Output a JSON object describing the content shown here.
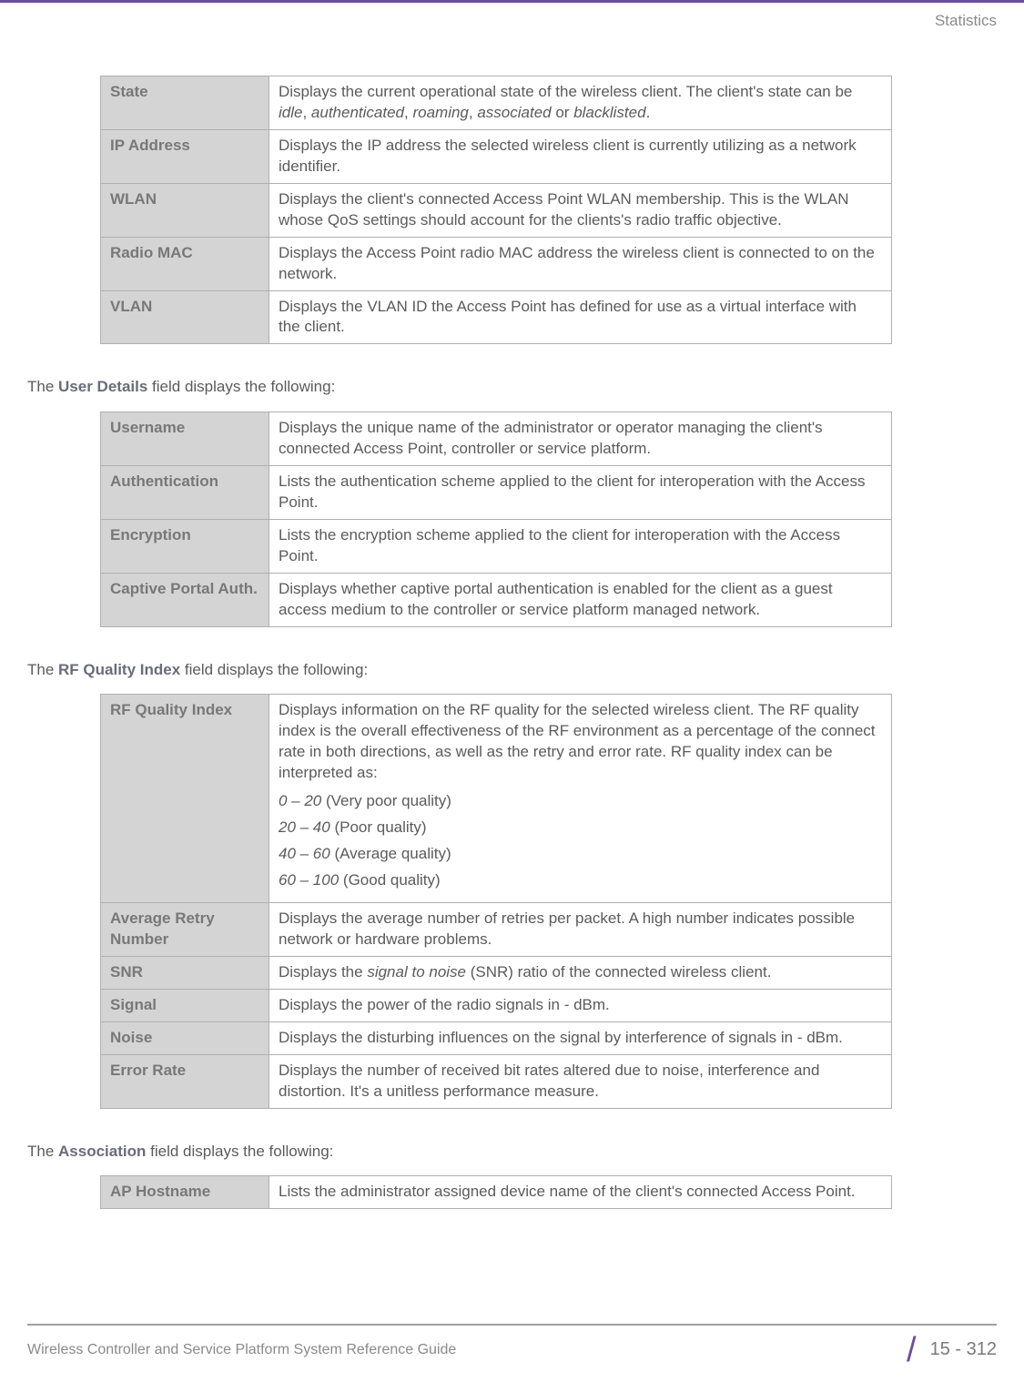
{
  "header": {
    "section_name": "Statistics"
  },
  "tables": {
    "client_details": {
      "rows": [
        {
          "label": "State",
          "description": "Displays the current operational state of the wireless client. The client's state can be <span class=\"italic\">idle</span>, <span class=\"italic\">authenticated</span>, <span class=\"italic\">roaming</span>, <span class=\"italic\">associated</span> or <span class=\"italic\">blacklisted</span>."
        },
        {
          "label": "IP Address",
          "description": "Displays the IP address the selected wireless client is currently utilizing as a network identifier."
        },
        {
          "label": "WLAN",
          "description": "Displays the client's connected Access Point WLAN membership. This is the WLAN whose QoS settings should account for the clients's radio traffic objective."
        },
        {
          "label": "Radio MAC",
          "description": "Displays the Access Point radio MAC address the wireless client is connected to on the network."
        },
        {
          "label": "VLAN",
          "description": "Displays the VLAN ID the Access Point has defined for use as a virtual interface with the client."
        }
      ]
    },
    "user_details": {
      "intro": "The <span class=\"bold-blue\">User Details</span> field displays the following:",
      "rows": [
        {
          "label": "Username",
          "description": "Displays the unique name of the administrator or operator managing the client's connected Access Point, controller or service platform."
        },
        {
          "label": "Authentication",
          "description": "Lists the authentication scheme applied to the client for interoperation with the Access Point."
        },
        {
          "label": "Encryption",
          "description": "Lists the encryption scheme applied to the client for interoperation with the Access Point."
        },
        {
          "label": "Captive Portal Auth.",
          "description": "Displays whether captive portal authentication is enabled for the client as a guest access medium to the controller or service platform managed network."
        }
      ]
    },
    "rf_quality": {
      "intro": "The <span class=\"bold-blue\">RF Quality Index</span> field displays the following:",
      "rows": [
        {
          "label": "RF Quality Index",
          "description": "Displays information on the RF quality for the selected wireless client. The RF quality index is the overall effectiveness of the RF environment as a percentage of the connect rate in both directions, as well as the retry and error rate. RF quality index can be interpreted as:<div class=\"rf-levels\"><div class=\"rf-level-item\"><span class=\"italic\">0 – 20</span> (Very poor quality)</div><div class=\"rf-level-item\"><span class=\"italic\">20 – 40</span> (Poor quality)</div><div class=\"rf-level-item\"><span class=\"italic\">40 – 60</span> (Average quality)</div><div class=\"rf-level-item\"><span class=\"italic\">60 – 100</span> (Good quality)</div></div>"
        },
        {
          "label": "Average Retry Number",
          "description": "Displays the average number of retries per packet. A high number indicates possible network or hardware problems."
        },
        {
          "label": "SNR",
          "description": "Displays the <span class=\"italic\">signal to noise</span> (SNR) ratio of the connected wireless client."
        },
        {
          "label": "Signal",
          "description": "Displays the power of the radio signals in - dBm."
        },
        {
          "label": "Noise",
          "description": "Displays the disturbing influences on the signal by interference of signals in - dBm."
        },
        {
          "label": "Error Rate",
          "description": "Displays the number of received bit rates altered due to noise, interference and distortion. It's a unitless performance measure."
        }
      ]
    },
    "association": {
      "intro": "The <span class=\"bold-blue\">Association</span> field displays the following:",
      "rows": [
        {
          "label": "AP Hostname",
          "description": "Lists the administrator assigned device name of the client's connected Access Point."
        }
      ]
    }
  },
  "footer": {
    "left_text": "Wireless Controller and Service Platform System Reference Guide",
    "page_number": "15 - 312"
  }
}
